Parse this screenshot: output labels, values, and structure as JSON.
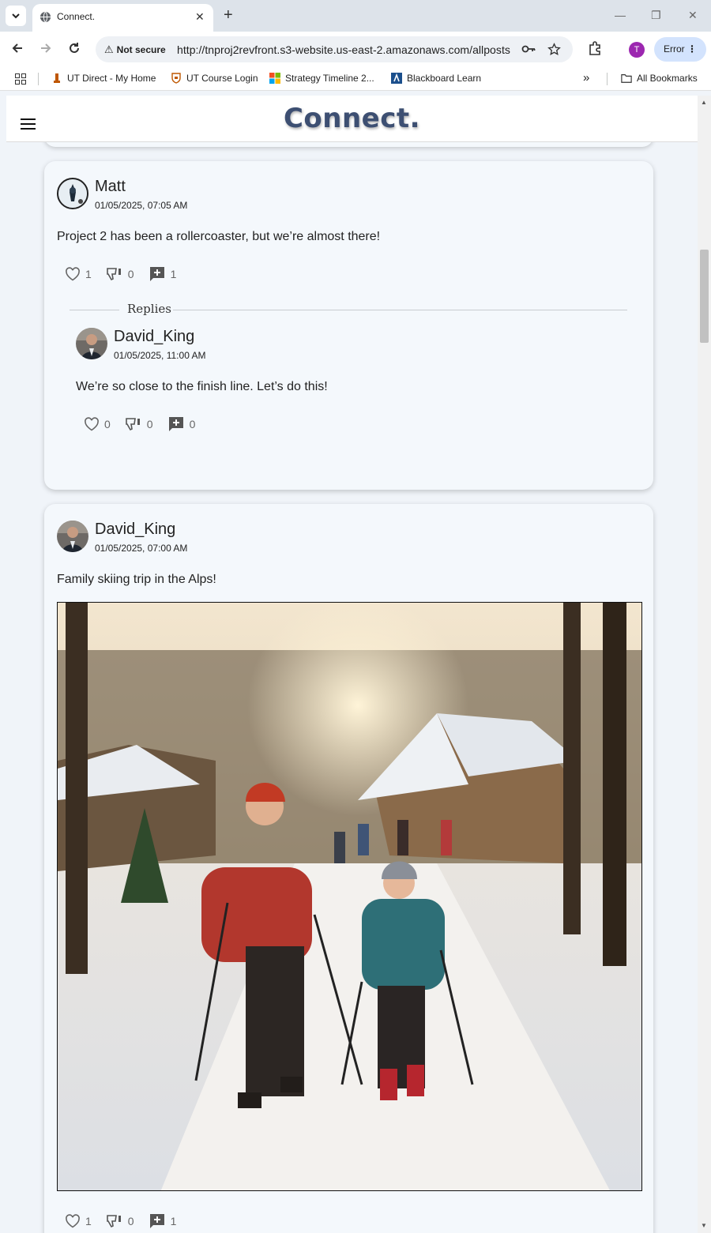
{
  "browser": {
    "tab_title": "Connect.",
    "security_label": "Not secure",
    "url": "http://tnproj2revfront.s3-website.us-east-2.amazonaws.com/allposts",
    "profile_initial": "T",
    "error_label": "Error",
    "bookmarks": [
      "UT Direct - My Home",
      "UT Course Login",
      "Strategy Timeline 2...",
      "Blackboard Learn"
    ],
    "overflow": "»",
    "all_bookmarks": "All Bookmarks"
  },
  "app": {
    "brand": "Connect."
  },
  "posts": [
    {
      "author": "Matt",
      "date": "01/05/2025, 07:05 AM",
      "text": "Project 2 has been a rollercoaster, but we’re almost there!",
      "likes": "1",
      "dislikes": "0",
      "comments": "1",
      "replies_label": "Replies",
      "replies": [
        {
          "author": "David_King",
          "date": "01/05/2025, 11:00 AM",
          "text": "We’re so close to the finish line. Let’s do this!",
          "likes": "0",
          "dislikes": "0",
          "comments": "0"
        }
      ]
    },
    {
      "author": "David_King",
      "date": "01/05/2025, 07:00 AM",
      "text": "Family skiing trip in the Alps!",
      "likes": "1",
      "dislikes": "0",
      "comments": "1"
    }
  ]
}
